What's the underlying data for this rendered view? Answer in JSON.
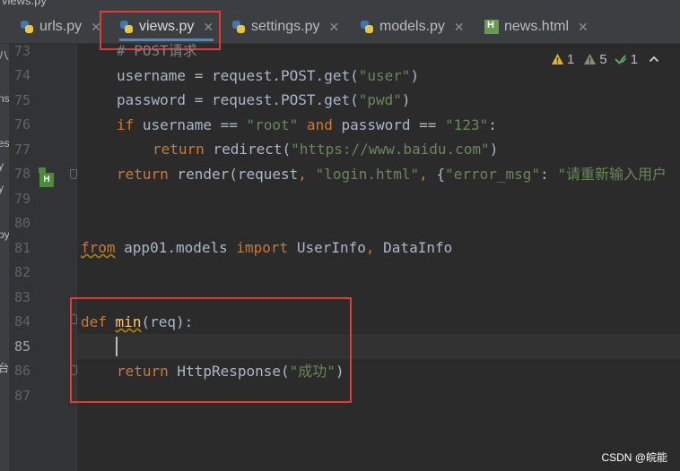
{
  "window": {
    "title_fragment": "views.py"
  },
  "tabs": [
    {
      "label": "urls.py",
      "icon": "python-file-icon",
      "active": false
    },
    {
      "label": "views.py",
      "icon": "python-file-icon",
      "active": true
    },
    {
      "label": "settings.py",
      "icon": "python-file-icon",
      "active": false
    },
    {
      "label": "models.py",
      "icon": "python-file-icon",
      "active": false
    },
    {
      "label": "news.html",
      "icon": "html-file-icon",
      "active": false
    }
  ],
  "tab_close_glyph": "✕",
  "left_panel": {
    "fragments": [
      "八",
      "ns",
      "es",
      "y",
      "y",
      "py",
      "台"
    ]
  },
  "inspections": {
    "warnings": "1",
    "weak_warnings": "5",
    "ok": "1"
  },
  "editor": {
    "line_numbers": [
      "73",
      "74",
      "75",
      "76",
      "77",
      "78",
      "79",
      "80",
      "81",
      "82",
      "83",
      "84",
      "85",
      "86",
      "87"
    ],
    "current_line": "85",
    "code": {
      "l73_comment": "# POST请求",
      "l74_a": "username = request.POST.get(",
      "l74_s": "\"user\"",
      "l74_b": ")",
      "l75_a": "password = request.POST.get(",
      "l75_s": "\"pwd\"",
      "l75_b": ")",
      "l76_if": "if",
      "l76_a": " username == ",
      "l76_s1": "\"root\"",
      "l76_and": " and",
      "l76_b": " password == ",
      "l76_s2": "\"123\"",
      "l76_c": ":",
      "l77_kw": "return",
      "l77_a": " redirect(",
      "l77_s": "\"https://www.baidu.com\"",
      "l77_b": ")",
      "l78_kw": "return",
      "l78_a": " render(request",
      "l78_c1": ",",
      "l78_s1": " \"login.html\"",
      "l78_c2": ",",
      "l78_b": " {",
      "l78_s2": "\"error_msg\"",
      "l78_d": ": ",
      "l78_s3": "\"请重新输入用户",
      "l81_from": "from",
      "l81_a": " app01.models ",
      "l81_import": "import",
      "l81_b": " UserInfo",
      "l81_c": ",",
      "l81_d": " DataInfo",
      "l84_def": "def",
      "l84_fn": "min",
      "l84_a": "(req):",
      "l86_kw": "return",
      "l86_a": " HttpResponse(",
      "l86_s": "\"成功\"",
      "l86_b": ")"
    }
  },
  "gutter_icon_label": "H",
  "watermark": "CSDN @皖能",
  "colors": {
    "highlight_box": "#e53935",
    "keyword": "#cc7832",
    "string": "#6a8759",
    "function": "#ffc66d"
  }
}
